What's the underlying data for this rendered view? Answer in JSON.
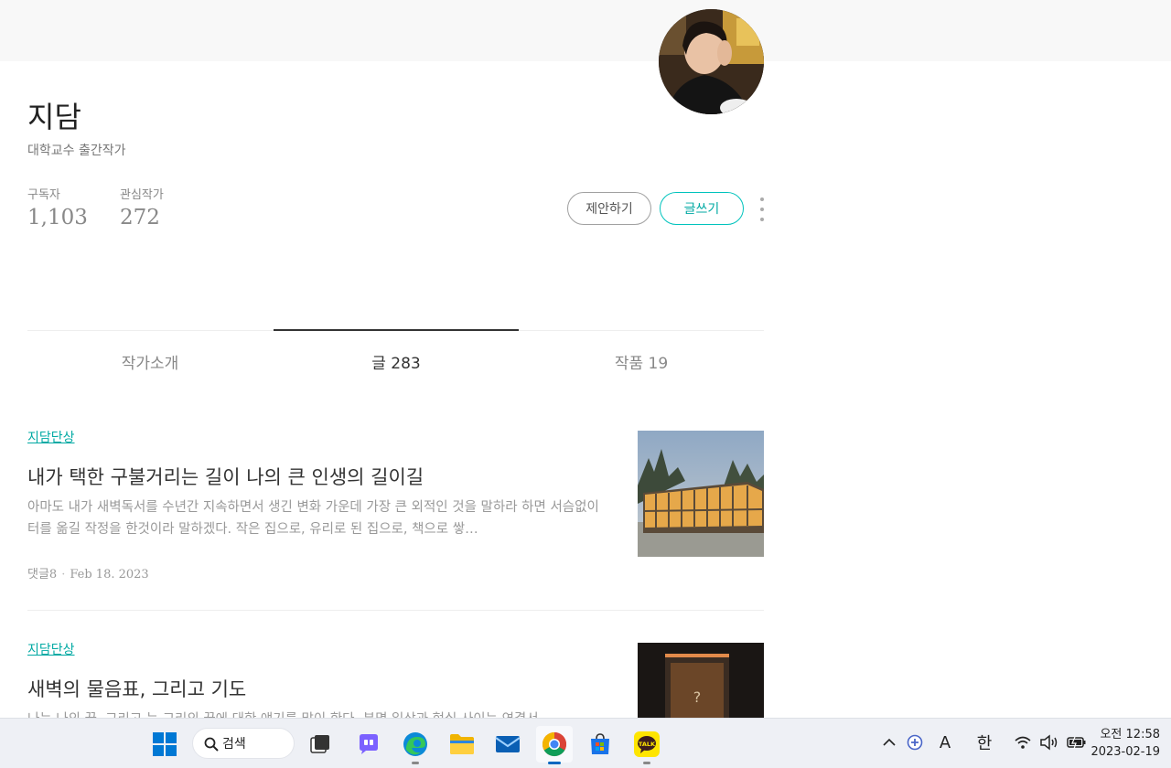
{
  "profile": {
    "name": "지담",
    "description": "대학교수 출간작가",
    "stats": [
      {
        "label": "구독자",
        "value": "1,103"
      },
      {
        "label": "관심작가",
        "value": "272"
      }
    ],
    "buttons": {
      "propose": "제안하기",
      "write": "글쓰기"
    }
  },
  "tabs": [
    {
      "label": "작가소개",
      "active": false
    },
    {
      "label": "글 283",
      "active": true
    },
    {
      "label": "작품 19",
      "active": false
    }
  ],
  "articles": [
    {
      "category": "지담단상",
      "title": "내가 택한 구불거리는 길이 나의 큰 인생의 길이길",
      "excerpt": "아마도 내가 새벽독서를 수년간 지속하면서 생긴 변화 가운데 가장 큰 외적인 것을 말하라 하면 서슴없이 터를 옮길 작정을 한것이라 말하겠다. 작은 집으로, 유리로 된 집으로, 책으로 쌓…",
      "comments": "댓글8",
      "date": "Feb 18. 2023"
    },
    {
      "category": "지담단상",
      "title": "새벽의 물음표, 그리고 기도",
      "excerpt": "나는 나의 끝, 그리고 눈 그리의 끝에 대한 얘기를 많이 한다. 분명 일상과 현실 사이는 연결서"
    }
  ],
  "taskbar": {
    "search_label": "검색",
    "tray": {
      "ime_letter": "A",
      "ime_lang": "한"
    },
    "clock": {
      "time": "오전 12:58",
      "date": "2023-02-19"
    }
  },
  "colors": {
    "accent": "#00a9a3",
    "accent_border": "#00c3bd"
  }
}
